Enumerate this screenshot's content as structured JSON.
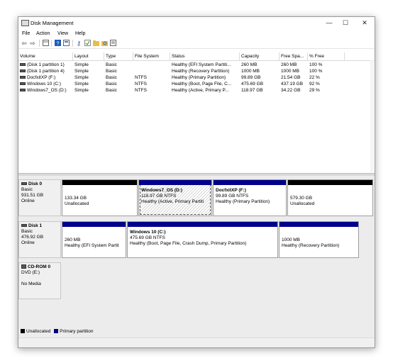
{
  "window": {
    "title": "Disk Management",
    "minimize": "—",
    "maximize": "☐",
    "close": "✕"
  },
  "menu": [
    "File",
    "Action",
    "View",
    "Help"
  ],
  "toolbar_icons": [
    "back-arrow-icon",
    "forward-arrow-icon",
    "grid-icon",
    "help-icon",
    "console-icon",
    "key-icon",
    "check-icon",
    "folder-icon",
    "search-folder-icon",
    "properties-icon"
  ],
  "volume_table": {
    "headers": [
      "Volume",
      "Layout",
      "Type",
      "File System",
      "Status",
      "Capacity",
      "Free Spa...",
      "% Free"
    ],
    "rows": [
      [
        "(Disk 1 partition 1)",
        "Simple",
        "Basic",
        "",
        "Healthy (EFI System Partiti...",
        "260 MB",
        "260 MB",
        "100 %"
      ],
      [
        "(Disk 1 partition 4)",
        "Simple",
        "Basic",
        "",
        "Healthy (Recovery Partition)",
        "1000 MB",
        "1000 MB",
        "100 %"
      ],
      [
        "DocfxitXP (F:)",
        "Simple",
        "Basic",
        "NTFS",
        "Healthy (Primary Partition)",
        "99.89 GB",
        "21.54 GB",
        "22 %"
      ],
      [
        "Windows 10 (C:)",
        "Simple",
        "Basic",
        "NTFS",
        "Healthy (Boot, Page File, C...",
        "475.69 GB",
        "437.19 GB",
        "92 %"
      ],
      [
        "Windows7_OS (D:)",
        "Simple",
        "Basic",
        "NTFS",
        "Healthy (Active, Primary P...",
        "118.97 GB",
        "34.22 GB",
        "29 %"
      ]
    ]
  },
  "disks": [
    {
      "name": "Disk 0",
      "type": "Basic",
      "size": "931.51 GB",
      "state": "Online",
      "partitions": [
        {
          "title": "",
          "line1": "133.34 GB",
          "line2": "Unallocated",
          "kind": "unallocated"
        },
        {
          "title": "Windows7_OS  (D:)",
          "line1": "118.97 GB NTFS",
          "line2": "Healthy (Active, Primary Partiti",
          "kind": "primary"
        },
        {
          "title": "DocfxitXP  (F:)",
          "line1": "99.89 GB NTFS",
          "line2": "Healthy (Primary Partition)",
          "kind": "primary"
        },
        {
          "title": "",
          "line1": "579.30 GB",
          "line2": "Unallocated",
          "kind": "unallocated"
        }
      ]
    },
    {
      "name": "Disk 1",
      "type": "Basic",
      "size": "476.92 GB",
      "state": "Online",
      "partitions": [
        {
          "title": "",
          "line1": "260 MB",
          "line2": "Healthy (EFI System Partit",
          "kind": "primary"
        },
        {
          "title": "Windows 10  (C:)",
          "line1": "475.69 GB NTFS",
          "line2": "Healthy (Boot, Page File, Crash Dump, Primary Partition)",
          "kind": "primary"
        },
        {
          "title": "",
          "line1": "1000 MB",
          "line2": "Healthy (Recovery Partition)",
          "kind": "primary"
        }
      ]
    },
    {
      "name": "CD-ROM 0",
      "type": "DVD (E:)",
      "size": "",
      "state": "No Media",
      "partitions": []
    }
  ],
  "legend": [
    {
      "label": "Unallocated",
      "color": "#000000"
    },
    {
      "label": "Primary partition",
      "color": "#000080"
    }
  ],
  "colors": {
    "unallocated": "#000000",
    "primary": "#00008b"
  }
}
